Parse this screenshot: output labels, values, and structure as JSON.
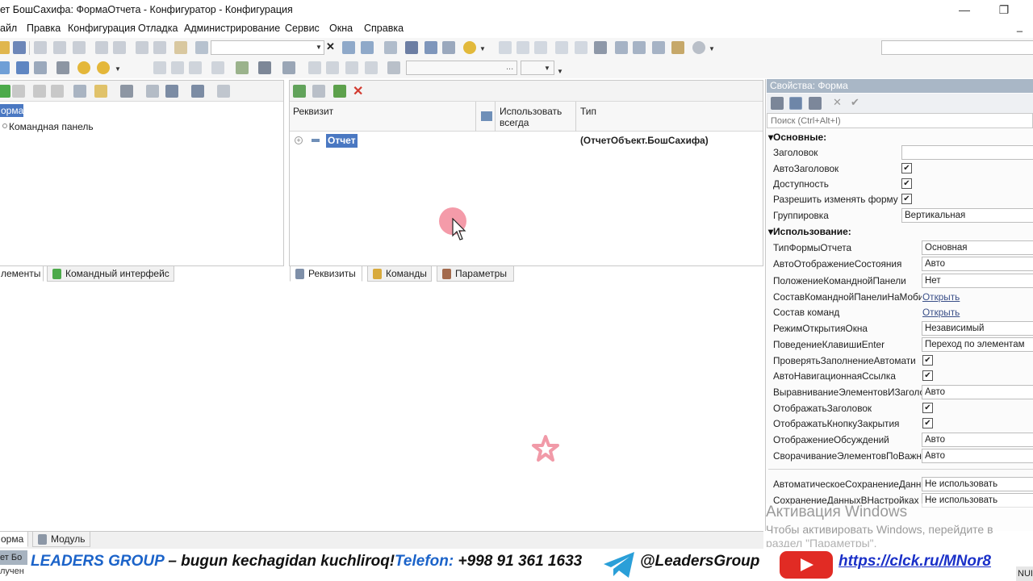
{
  "window": {
    "title": "ет БошСахифа: ФормаОтчета - Конфигуратор - Конфигурация",
    "minimize_glyph": "—",
    "restore_glyph": "❐",
    "close_glyph": "✕",
    "inner_minimize_glyph": "_"
  },
  "menu": {
    "items": [
      "айл",
      "Правка",
      "Конфигурация",
      "Отладка",
      "Администрирование",
      "Сервис",
      "Окна",
      "Справка"
    ]
  },
  "toolbar": {
    "clear_glyph": "✕",
    "dots": "..."
  },
  "left_panel": {
    "root_label": "орма",
    "child_label": "Командная панель",
    "tabs": [
      "лементы",
      "Командный интерфейс"
    ]
  },
  "center_panel": {
    "columns": [
      "Реквизит",
      "Использовать всегда",
      "Тип"
    ],
    "rows": [
      {
        "name": "Отчет",
        "type": "(ОтчетОбъект.БошСахифа)"
      }
    ],
    "tabs": [
      "Реквизиты",
      "Команды",
      "Параметры"
    ]
  },
  "bottom_tabs": [
    "орма",
    "Модуль"
  ],
  "properties": {
    "title": "Свойства: Форма",
    "search_placeholder": "Поиск (Ctrl+Alt+I)",
    "sections": [
      "Основные:",
      "Использование:"
    ],
    "basic": [
      {
        "label": "Заголовок",
        "kind": "field",
        "value": ""
      },
      {
        "label": "АвтоЗаголовок",
        "kind": "check",
        "checked": true
      },
      {
        "label": "Доступность",
        "kind": "check",
        "checked": true
      },
      {
        "label": "Разрешить изменять форму",
        "kind": "check",
        "checked": true
      },
      {
        "label": "Группировка",
        "kind": "field",
        "value": "Вертикальная"
      }
    ],
    "usage": [
      {
        "label": "ТипФормыОтчета",
        "kind": "field",
        "value": "Основная"
      },
      {
        "label": "АвтоОтображениеСостояния",
        "kind": "field",
        "value": "Авто"
      },
      {
        "label": "ПоложениеКоманднойПанели",
        "kind": "field",
        "value": "Нет"
      },
      {
        "label": "СоставКоманднойПанелиНаМоби",
        "kind": "link",
        "value": "Открыть"
      },
      {
        "label": "Состав команд",
        "kind": "link",
        "value": "Открыть"
      },
      {
        "label": "РежимОткрытияОкна",
        "kind": "field",
        "value": "Независимый"
      },
      {
        "label": "ПоведениеКлавишиEnter",
        "kind": "field",
        "value": "Переход по элементам"
      },
      {
        "label": "ПроверятьЗаполнениеАвтомати",
        "kind": "check",
        "checked": true
      },
      {
        "label": "АвтоНавигационнаяСсылка",
        "kind": "check",
        "checked": true
      },
      {
        "label": "ВыравниваниеЭлементовИЗаголо",
        "kind": "field",
        "value": "Авто"
      },
      {
        "label": "ОтображатьЗаголовок",
        "kind": "check",
        "checked": true
      },
      {
        "label": "ОтображатьКнопкуЗакрытия",
        "kind": "check",
        "checked": true
      },
      {
        "label": "ОтображениеОбсуждений",
        "kind": "field",
        "value": "Авто"
      },
      {
        "label": "СворачиваниеЭлементовПоВажн",
        "kind": "field",
        "value": "Авто"
      }
    ],
    "extra": [
      {
        "label": "АвтоматическоеСохранениеДанн",
        "kind": "field",
        "value": "Не использовать"
      },
      {
        "label": "СохранениеДанныхВНастройках",
        "kind": "field",
        "value": "Не использовать"
      }
    ]
  },
  "watermark": {
    "line1": "Активация Windows",
    "line2": "Чтобы активировать Windows, перейдите в",
    "line3": "раздел \"Параметры\"."
  },
  "status": {
    "left1": "ет Бо",
    "left2": "лучен",
    "right": "NUI"
  },
  "banner": {
    "brand": "LEADERS GROUP",
    "slogan": "– bugun kechagidan kuchliroq!",
    "phone_label": "Telefon:",
    "phone": "+998 91 361 1633",
    "telegram": "@LeadersGroup",
    "url": "https://clck.ru/MNor8"
  },
  "colors": {
    "selection": "#4a78c2",
    "banner_blue": "#1b63c9",
    "link": "#1a30c8",
    "telegram": "#2a9fd8",
    "youtube": "#e12b24",
    "cursor_highlight": "#f07a8c"
  }
}
